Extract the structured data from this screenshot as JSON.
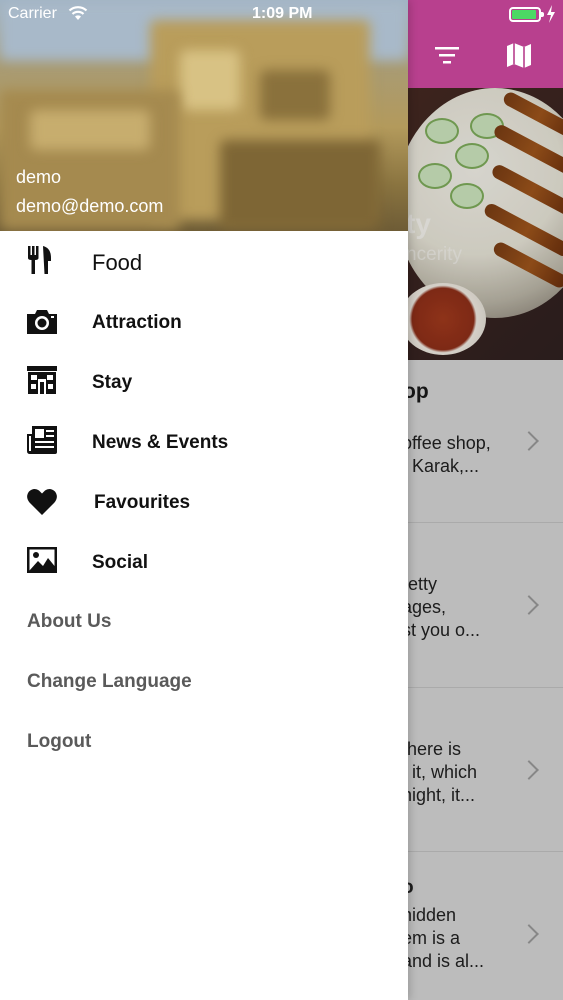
{
  "status_bar": {
    "carrier": "Carrier",
    "time": "1:09 PM",
    "battery_color": "#4cd964"
  },
  "nav_bar": {
    "color": "#b8408e",
    "icons": [
      "filter-icon",
      "map-icon"
    ]
  },
  "hero": {
    "title": "ty",
    "subtitle": "ncerity"
  },
  "list": {
    "header": "op",
    "cards": [
      {
        "lines": "offee shop,\nf Karak,..."
      },
      {
        "lines": "retty\nages,\nst you o..."
      },
      {
        "lines": "there is\n: it, which\nnight, it..."
      },
      {
        "title": "o",
        "lines": "hidden\nem is a\nand is al..."
      }
    ]
  },
  "drawer": {
    "user": {
      "name": "demo",
      "email": "demo@demo.com"
    },
    "menu_items": [
      {
        "label": "Food",
        "icon": "cutlery-icon"
      },
      {
        "label": "Attraction",
        "icon": "camera-icon"
      },
      {
        "label": "Stay",
        "icon": "building-icon"
      },
      {
        "label": "News & Events",
        "icon": "newspaper-icon"
      },
      {
        "label": "Favourites",
        "icon": "heart-icon"
      },
      {
        "label": "Social",
        "icon": "image-icon"
      }
    ],
    "links": [
      "About Us",
      "Change Language",
      "Logout"
    ]
  }
}
